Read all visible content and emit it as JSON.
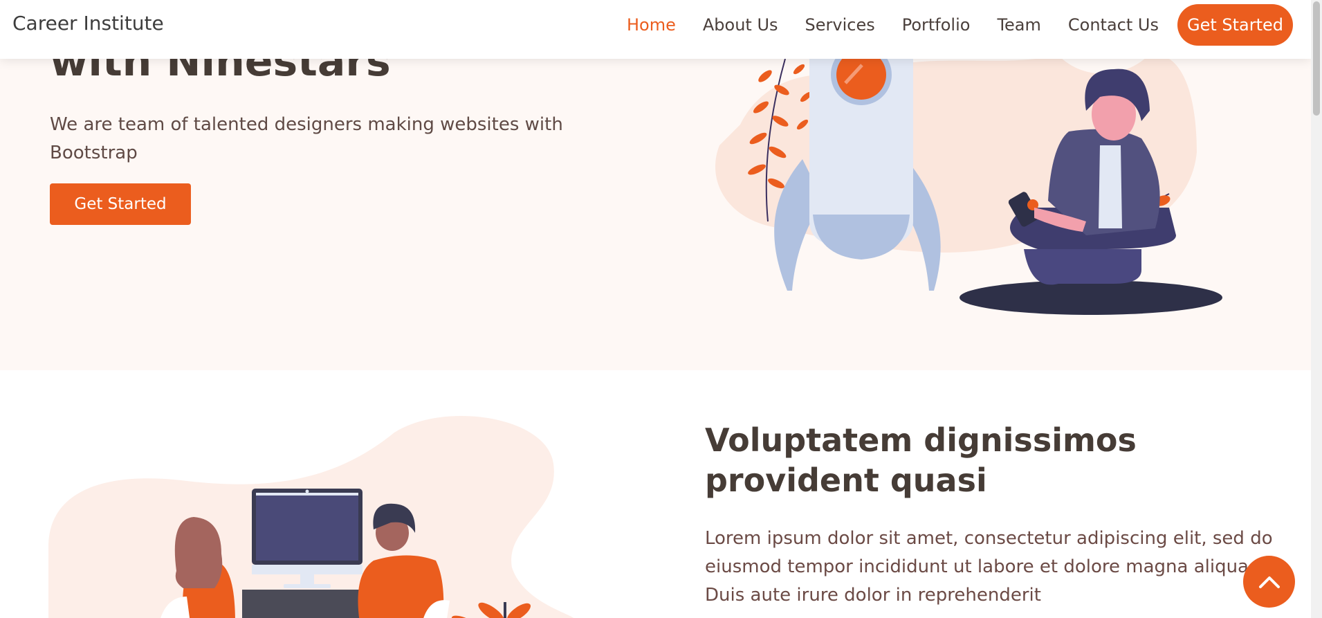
{
  "header": {
    "logo": "Career Institute",
    "nav": [
      "Home",
      "About Us",
      "Services",
      "Portfolio",
      "Team",
      "Contact Us"
    ],
    "cta": "Get Started"
  },
  "hero": {
    "title": "with Ninestars",
    "subtitle": "We are team of talented designers making websites with Bootstrap",
    "button": "Get Started"
  },
  "about": {
    "title": "Voluptatem dignissimos provident quasi",
    "text": "Lorem ipsum dolor sit amet, consectetur adipiscing elit, sed do eiusmod tempor incididunt ut labore et dolore magna aliqua. Duis aute irure dolor in reprehenderit"
  },
  "icons": {
    "back_to_top": "chevron-up-icon"
  },
  "colors": {
    "accent": "#eb5d1e",
    "hero_bg": "#fef8f5",
    "heading": "#463c36"
  }
}
